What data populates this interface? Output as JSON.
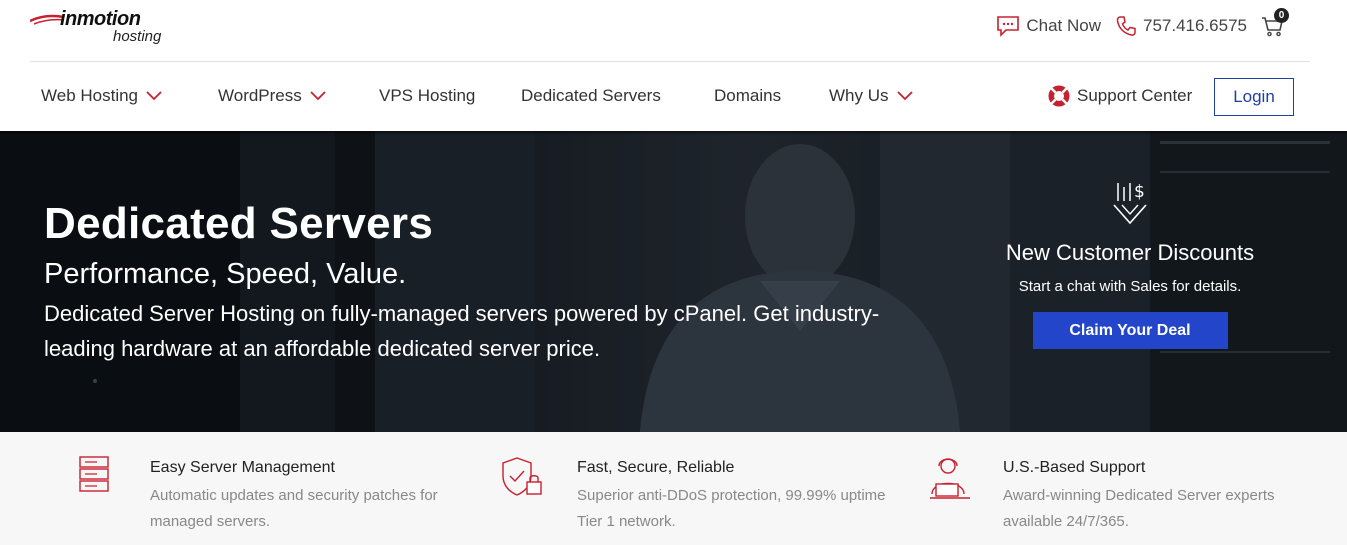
{
  "brand": {
    "name": "inmotion",
    "sub": "hosting"
  },
  "topbar": {
    "chat_label": "Chat Now",
    "phone": "757.416.6575",
    "cart_count": "0"
  },
  "nav": {
    "items": [
      {
        "label": "Web Hosting",
        "dropdown": true
      },
      {
        "label": "WordPress",
        "dropdown": true
      },
      {
        "label": "VPS Hosting",
        "dropdown": false
      },
      {
        "label": "Dedicated Servers",
        "dropdown": false
      },
      {
        "label": "Domains",
        "dropdown": false
      },
      {
        "label": "Why Us",
        "dropdown": true
      }
    ],
    "support_label": "Support Center",
    "login_label": "Login"
  },
  "hero": {
    "title": "Dedicated Servers",
    "subtitle": "Performance, Speed, Value.",
    "description": "Dedicated Server Hosting on fully-managed servers powered by cPanel. Get industry-leading hardware at an affordable dedicated server price."
  },
  "promo": {
    "title": "New Customer Discounts",
    "text": "Start a chat with Sales for details.",
    "button": "Claim Your Deal"
  },
  "features": [
    {
      "icon": "server-stack-icon",
      "title": "Easy Server Management",
      "description": "Automatic updates and security patches for managed servers."
    },
    {
      "icon": "shield-lock-icon",
      "title": "Fast, Secure, Reliable",
      "description": "Superior anti-DDoS protection, 99.99% uptime Tier 1 network."
    },
    {
      "icon": "support-agent-icon",
      "title": "U.S.-Based Support",
      "description": "Award-winning Dedicated Server experts available 24/7/365."
    }
  ],
  "colors": {
    "accent_red": "#c8202f",
    "brand_blue": "#2245c9",
    "login_blue": "#1e3fa8"
  }
}
